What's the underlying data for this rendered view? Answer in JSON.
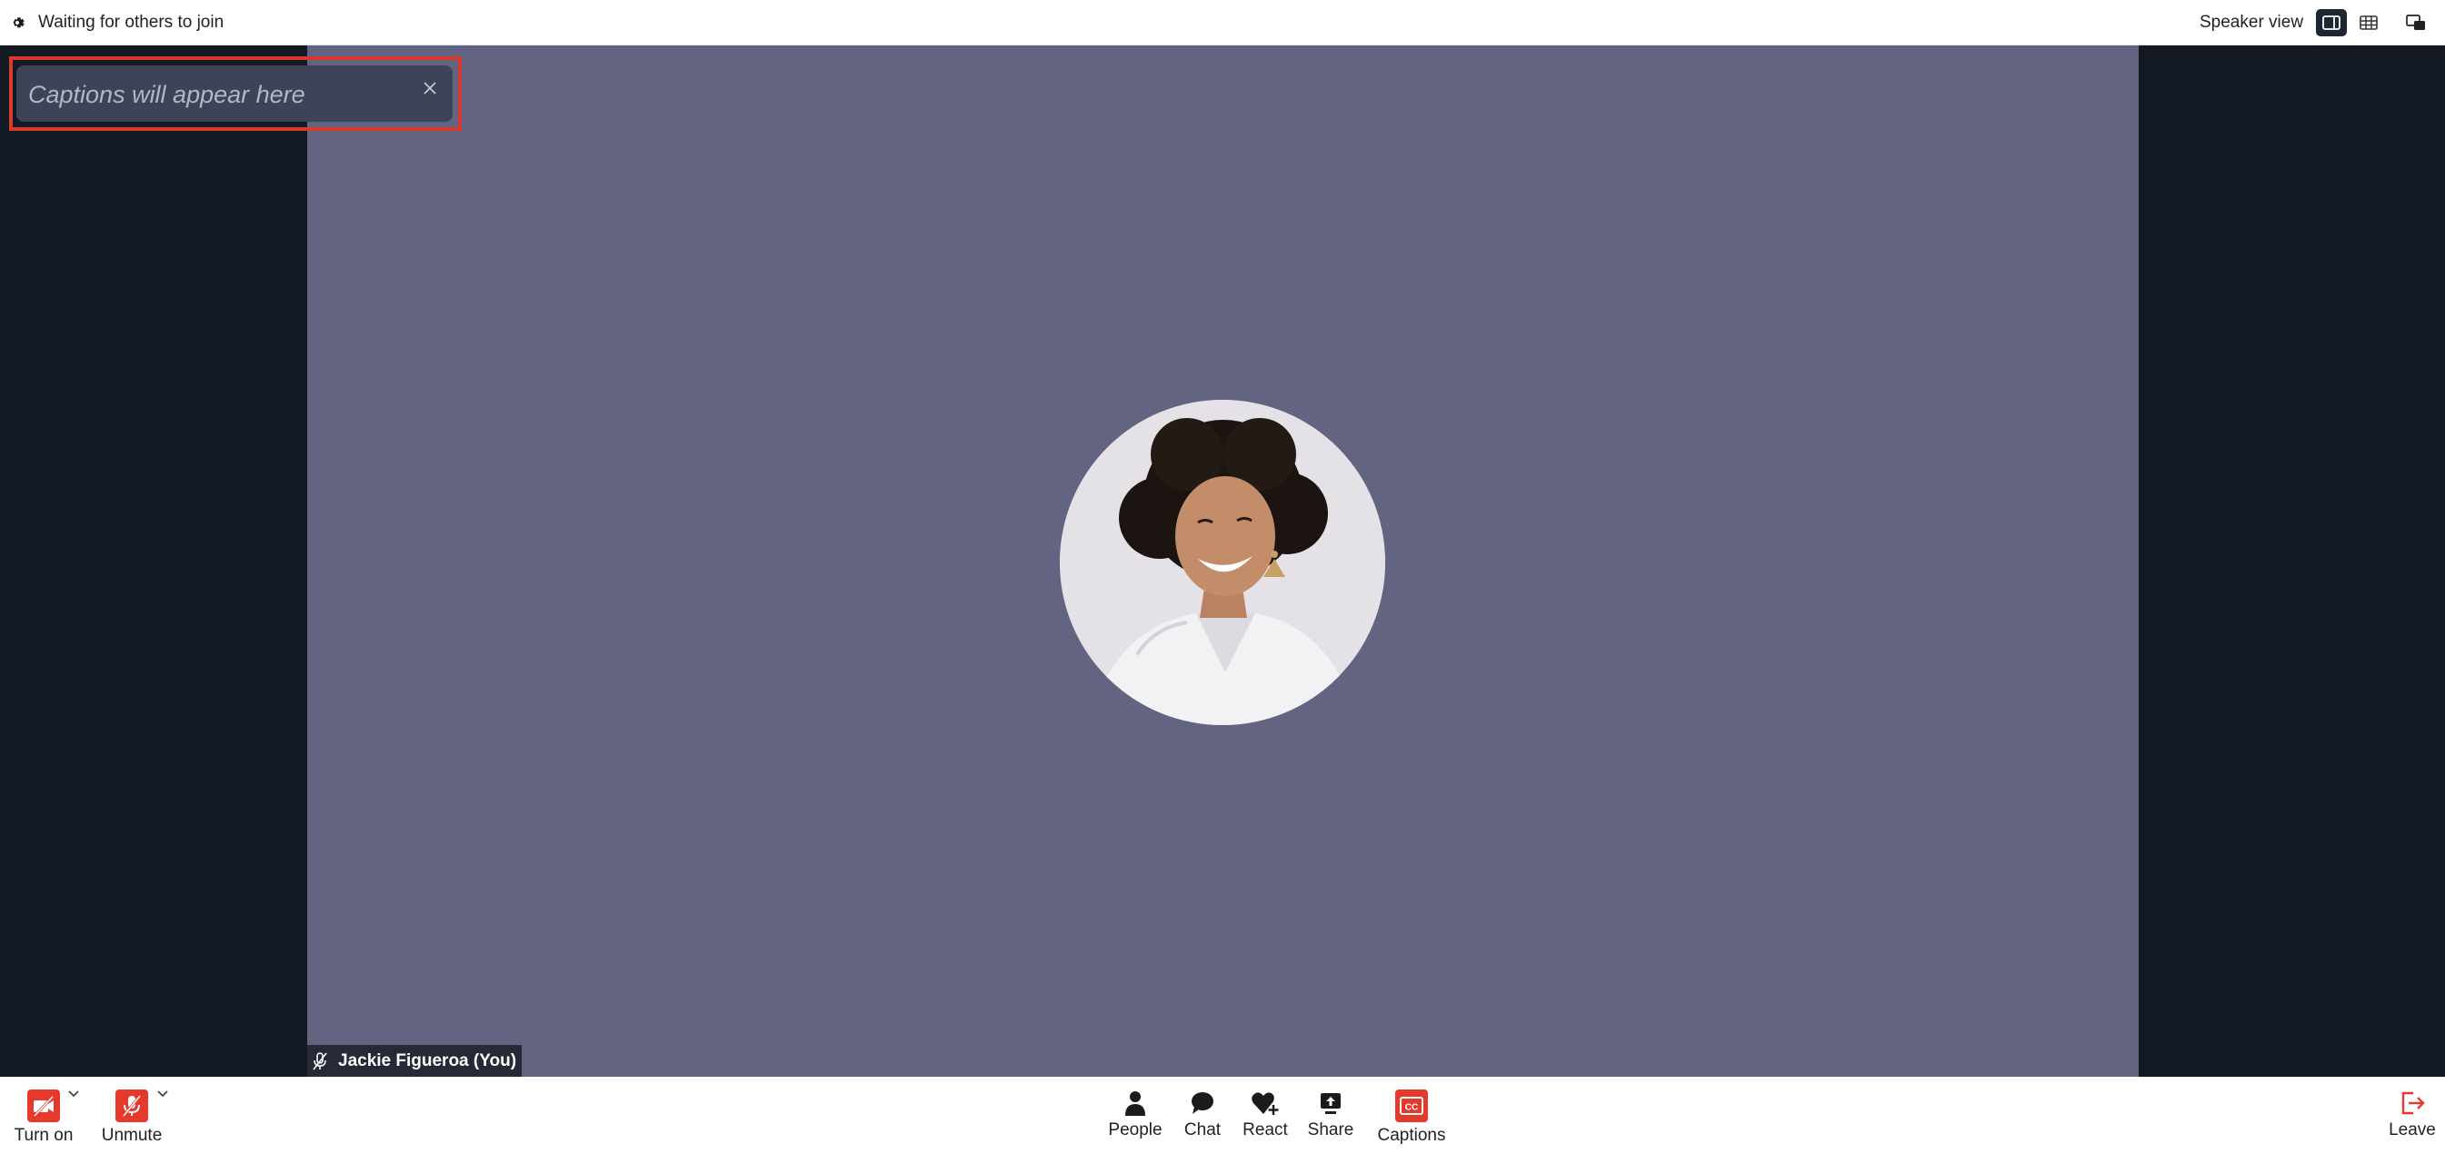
{
  "topbar": {
    "status": "Waiting for others to join",
    "view_label": "Speaker view",
    "icons": [
      "gear-icon",
      "speaker-view-icon",
      "grid-view-icon",
      "popout-icon"
    ]
  },
  "captions": {
    "placeholder": "Captions will appear here",
    "close_icon": "close-icon"
  },
  "participant": {
    "name": "Jackie Figueroa (You)",
    "muted": true
  },
  "controls": {
    "camera_label": "Turn on",
    "mic_label": "Unmute",
    "people_label": "People",
    "chat_label": "Chat",
    "react_label": "React",
    "share_label": "Share",
    "captions_label": "Captions",
    "leave_label": "Leave"
  },
  "colors": {
    "accent_red": "#e5392b",
    "highlight_outline": "#d93a2b",
    "stage_bg": "#131a24",
    "tile_bg": "#636481",
    "caption_bg": "#3e4457"
  }
}
